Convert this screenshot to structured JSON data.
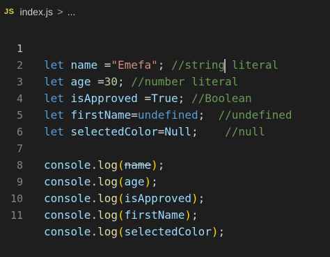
{
  "breadcrumb": {
    "badge": "JS",
    "file": "index.js",
    "separator": ">",
    "more": "..."
  },
  "editor": {
    "lines": [
      {
        "number": "1",
        "kw": "let",
        "var": "name",
        "op": " =",
        "val": "\"Emefa\"",
        "semi": ";",
        "gap": " ",
        "comment_a": "//string",
        "comment_b": " literal"
      },
      {
        "number": "2",
        "kw": "let",
        "var": "age",
        "op": " =",
        "val": "30",
        "semi": ";",
        "gap": " ",
        "comment": "//number literal"
      },
      {
        "number": "3",
        "kw": "let",
        "var": "isApproved",
        "op": " =",
        "val": "True",
        "semi": ";",
        "gap": " ",
        "comment": "//Boolean"
      },
      {
        "number": "4",
        "kw": "let",
        "var": "firstName",
        "op": "=",
        "val": "undefined",
        "semi": ";",
        "gap": "  ",
        "comment": "//undefined"
      },
      {
        "number": "5",
        "kw": "let",
        "var": "selectedColor",
        "op": "=",
        "val": "Null",
        "semi": ";",
        "gap": "    ",
        "comment": "//null"
      },
      {
        "number": "6"
      },
      {
        "number": "7",
        "obj": "console",
        "dot": ".",
        "fn": "log",
        "open": "(",
        "arg": "name",
        "close": ")",
        "semi": ";"
      },
      {
        "number": "8",
        "obj": "console",
        "dot": ".",
        "fn": "log",
        "open": "(",
        "arg": "age",
        "close": ")",
        "semi": ";"
      },
      {
        "number": "9",
        "obj": "console",
        "dot": ".",
        "fn": "log",
        "open": "(",
        "arg": "isApproved",
        "close": ")",
        "semi": ";"
      },
      {
        "number": "10",
        "obj": "console",
        "dot": ".",
        "fn": "log",
        "open": "(",
        "arg": "firstName",
        "close": ")",
        "semi": ";"
      },
      {
        "number": "11",
        "obj": "console",
        "dot": ".",
        "fn": "log",
        "open": "(",
        "arg": "selectedColor",
        "close": ")",
        "semi": ";"
      }
    ]
  },
  "colors": {
    "background": "#1e1e1e",
    "keyword": "#569cd6",
    "variable": "#9cdcfe",
    "string": "#ce9178",
    "number": "#b5cea8",
    "comment": "#6a9955",
    "function": "#dcdcaa",
    "bracket": "#ffd700"
  }
}
